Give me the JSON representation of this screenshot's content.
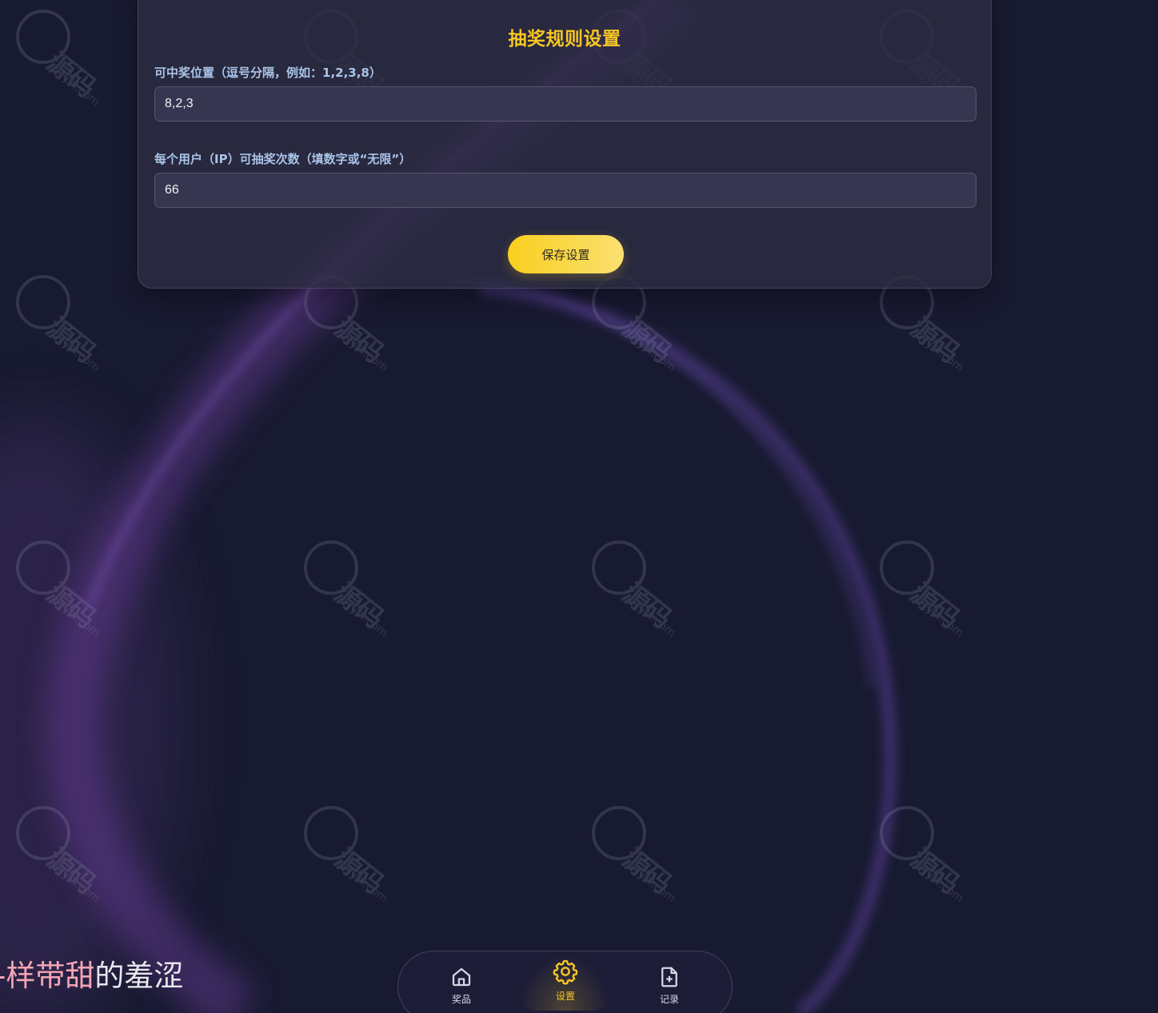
{
  "settings": {
    "title": "抽奖规则设置",
    "win_positions": {
      "label": "可中奖位置（逗号分隔，例如：1,2,3,8）",
      "value": "8,2,3"
    },
    "draws_per_user": {
      "label": "每个用户（IP）可抽奖次数（填数字或“无限”）",
      "value": "66"
    },
    "save_label": "保存设置"
  },
  "lyric": {
    "highlighted": "-样带甜",
    "rest": "的羞涩"
  },
  "nav": {
    "items": [
      {
        "label": "奖品",
        "icon": "home-icon"
      },
      {
        "label": "设置",
        "icon": "gear-icon",
        "active": true
      },
      {
        "label": "记录",
        "icon": "file-plus-icon"
      }
    ]
  },
  "colors": {
    "background": "#181a31",
    "accent": "#f7c623",
    "label": "#a9c4e8",
    "lyric_highlight": "#f4a5b4"
  }
}
